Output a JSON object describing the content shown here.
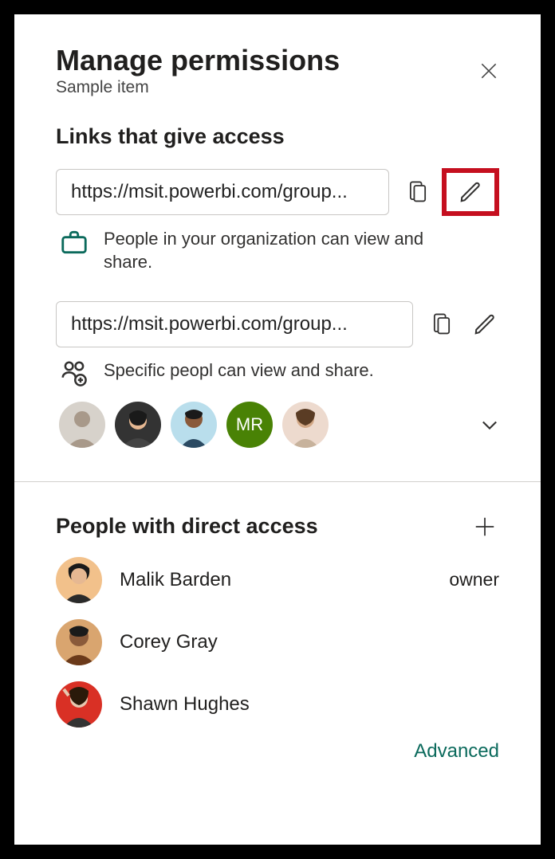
{
  "header": {
    "title": "Manage permissions",
    "subtitle": "Sample item"
  },
  "links_section_title": "Links that give access",
  "links": [
    {
      "url": "https://msit.powerbi.com/group...",
      "desc": "People in your organization can view and share.",
      "highlighted_edit": true,
      "icon": "briefcase",
      "avatars": []
    },
    {
      "url": "https://msit.powerbi.com/group...",
      "desc": "Specific peopl can view and share.",
      "highlighted_edit": false,
      "icon": "specific-people",
      "avatars": [
        {
          "type": "img",
          "bg": "#d7d2cb"
        },
        {
          "type": "img",
          "bg": "#e6b892"
        },
        {
          "type": "img",
          "bg": "#b9deec"
        },
        {
          "type": "initials",
          "text": "MR",
          "bg": "#498205"
        },
        {
          "type": "img",
          "bg": "#eddace"
        }
      ]
    }
  ],
  "direct_section_title": "People with direct access",
  "people": [
    {
      "name": "Malik Barden",
      "role": "owner",
      "bg": "#f2c18b"
    },
    {
      "name": "Corey Gray",
      "role": "",
      "bg": "#d9a56f"
    },
    {
      "name": "Shawn Hughes",
      "role": "",
      "bg": "#d93025"
    }
  ],
  "advanced_label": "Advanced"
}
